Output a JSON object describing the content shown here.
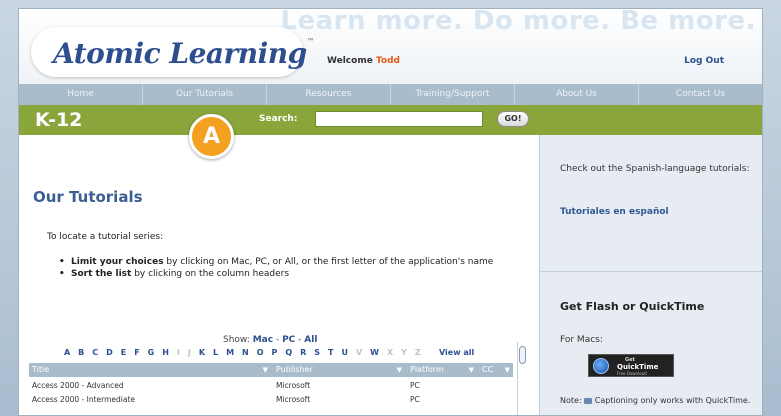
{
  "header": {
    "slogan": "Learn more. Do more. Be more.",
    "logo": "Atomic Learning",
    "logo_tm": "™",
    "welcome_prefix": "Welcome",
    "user": "Todd",
    "logout": "Log Out"
  },
  "nav": [
    "Home",
    "Our Tutorials",
    "Resources",
    "Training/Support",
    "About Us",
    "Contact Us"
  ],
  "bar": {
    "title": "K-12",
    "search_label": "Search:",
    "search_value": "",
    "go": "GO!"
  },
  "main": {
    "heading": "Our Tutorials",
    "intro": "To locate a tutorial series:",
    "bullet1_bold": "Limit your choices",
    "bullet1_rest": " by clicking on Mac, PC, or All, or the first letter of the application's name",
    "bullet2_bold": "Sort the list",
    "bullet2_rest": " by clicking on the column headers",
    "show_label": "Show:",
    "show_mac": "Mac",
    "show_pc": "PC",
    "show_all": "All",
    "sep": "-",
    "letters_active": "A B C D E F G H",
    "letter_i": "I",
    "letter_j": "J",
    "letters_mid": "K L M N O P Q R S T U",
    "letter_v": "V",
    "letter_w": "W",
    "letters_end": "X Y Z",
    "view_all": "View all"
  },
  "table": {
    "headers": [
      "Title",
      "Publisher",
      "Platform",
      "CC"
    ],
    "header_arrow": "▼",
    "rows": [
      [
        "Access 2000 - Advanced",
        "Microsoft",
        "PC"
      ],
      [
        "Access 2000 - Intermediate",
        "Microsoft",
        "PC"
      ]
    ]
  },
  "side": {
    "promo": "Check out the Spanish-language tutorials:",
    "promo_link": "Tutoriales en español",
    "heading": "Get Flash or QuickTime",
    "for_macs": "For Macs:",
    "qt_get": "Get",
    "qt_name": "QuickTime",
    "qt_free": "Free Download",
    "note_prefix": "Note:",
    "note_rest": "Captioning only works with QuickTime."
  },
  "annotation": {
    "label": "A"
  }
}
